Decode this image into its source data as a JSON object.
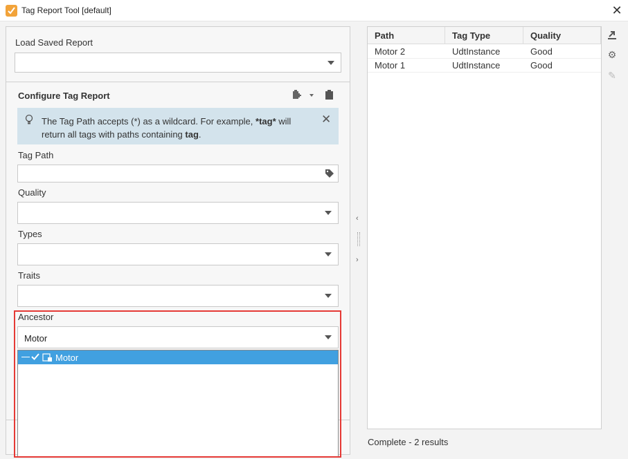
{
  "window": {
    "title": "Tag Report Tool [default]"
  },
  "left": {
    "load_saved_label": "Load Saved Report",
    "load_saved_value": "",
    "configure_title": "Configure Tag Report",
    "info": {
      "line1_pre": "The Tag Path accepts (*) as a wildcard. For example, ",
      "line1_bold": "*tag*",
      "line1_post": " will",
      "line2_pre": "return all tags with paths containing ",
      "line2_bold": "tag",
      "line2_post": "."
    },
    "tag_path_label": "Tag Path",
    "tag_path_value": "",
    "quality_label": "Quality",
    "quality_value": "",
    "types_label": "Types",
    "types_value": "",
    "traits_label": "Traits",
    "traits_value": "",
    "ancestor_label": "Ancestor",
    "ancestor_value": "Motor",
    "ancestor_options": [
      {
        "label": "Motor",
        "checked": true
      }
    ]
  },
  "table": {
    "columns": [
      "Path",
      "Tag Type",
      "Quality"
    ],
    "rows": [
      [
        "Motor 2",
        "UdtInstance",
        "Good"
      ],
      [
        "Motor 1",
        "UdtInstance",
        "Good"
      ]
    ]
  },
  "status": "Complete - 2 results",
  "icons": [
    "app-icon",
    "close-icon",
    "paste-icon",
    "chevron-down-icon",
    "clipboard-icon",
    "lightbulb-icon",
    "tag-icon",
    "export-icon",
    "gear-icon",
    "pencil-icon",
    "checkmark-icon",
    "tag-type-icon"
  ]
}
